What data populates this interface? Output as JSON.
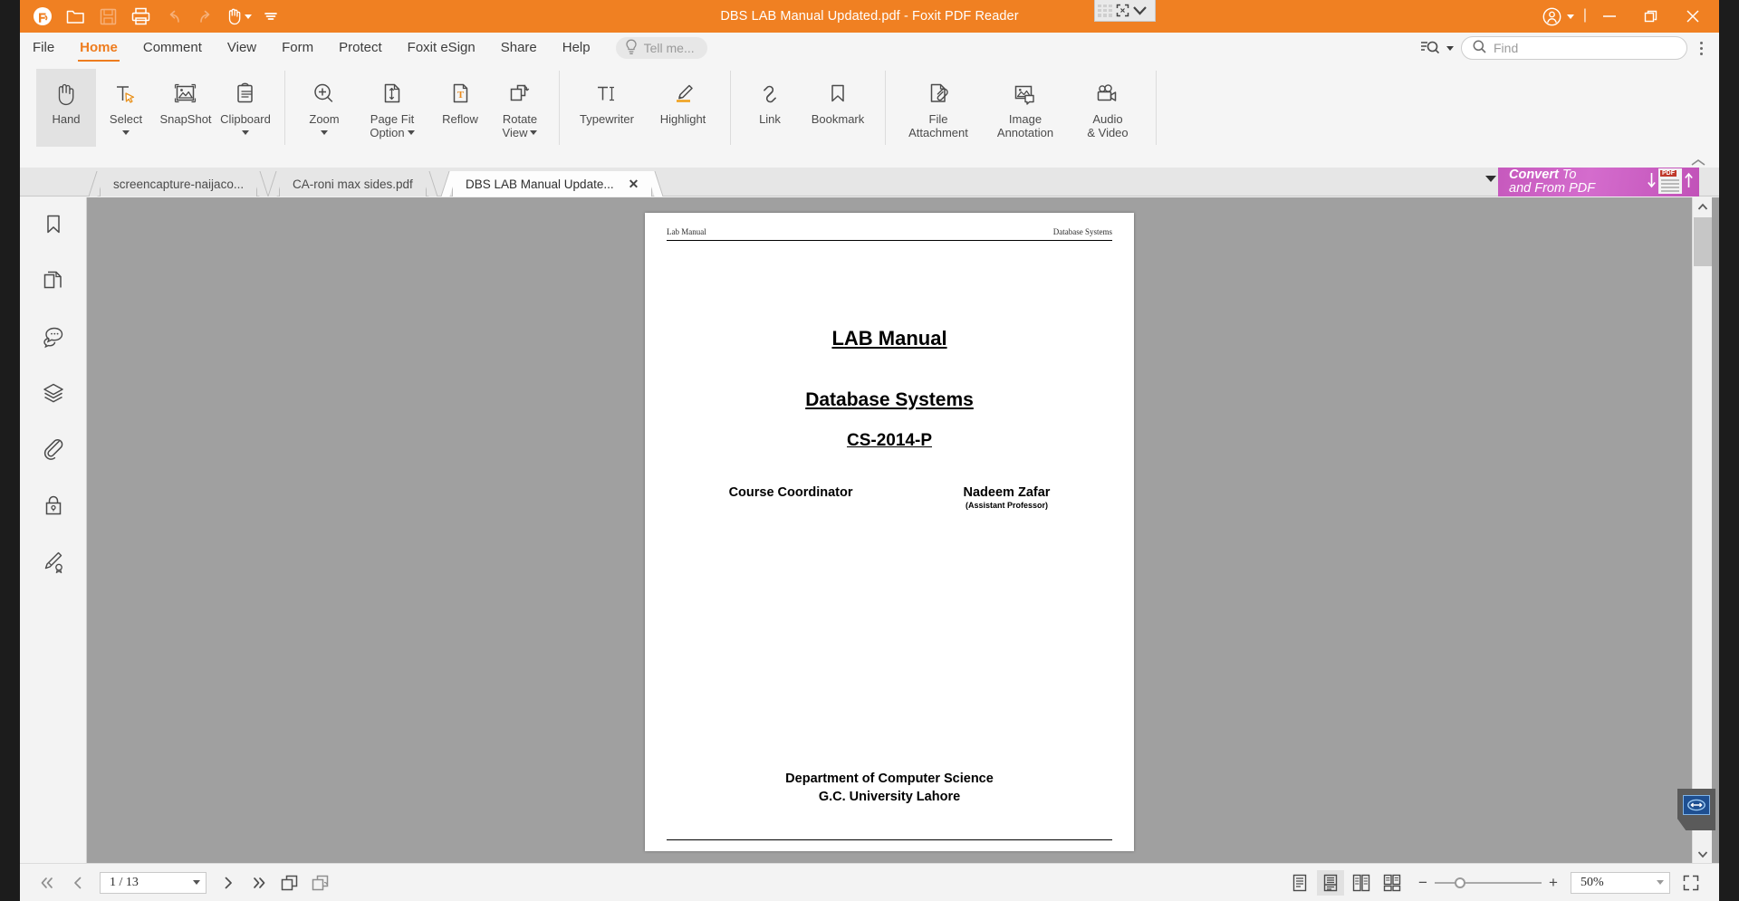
{
  "window": {
    "title": "DBS LAB Manual Updated.pdf - Foxit PDF Reader",
    "accent_color": "#f08022",
    "quick_access": [
      {
        "name": "foxit-logo-icon",
        "label": "Foxit"
      },
      {
        "name": "open-icon",
        "label": "Open"
      },
      {
        "name": "save-icon",
        "label": "Save"
      },
      {
        "name": "print-icon",
        "label": "Print"
      },
      {
        "name": "undo-icon",
        "label": "Undo"
      },
      {
        "name": "redo-icon",
        "label": "Redo"
      },
      {
        "name": "hand-tool-icon",
        "label": "Hand Tool"
      },
      {
        "name": "quick-access-more-icon",
        "label": "Customize Quick Access Toolbar"
      }
    ],
    "controls": {
      "account": "Account",
      "minimize": "Minimize",
      "restore": "Restore",
      "close": "Close"
    },
    "float_widget": {
      "grid": "app-grid-icon",
      "expand": "expand-icon",
      "chevron": "chevron-down-icon"
    }
  },
  "menu": {
    "items": [
      {
        "label": "File",
        "active": false
      },
      {
        "label": "Home",
        "active": true
      },
      {
        "label": "Comment",
        "active": false
      },
      {
        "label": "View",
        "active": false
      },
      {
        "label": "Form",
        "active": false
      },
      {
        "label": "Protect",
        "active": false
      },
      {
        "label": "Foxit eSign",
        "active": false
      },
      {
        "label": "Share",
        "active": false
      },
      {
        "label": "Help",
        "active": false
      }
    ],
    "tell_me_placeholder": "Tell me...",
    "find_placeholder": "Find",
    "search_options_label": "Search options",
    "more_label": "More"
  },
  "ribbon": {
    "groups": [
      {
        "buttons": [
          {
            "label": "Hand",
            "icon": "hand-icon",
            "selected": true,
            "dropdown": false
          },
          {
            "label": "Select",
            "icon": "select-text-icon",
            "selected": false,
            "dropdown": true
          },
          {
            "label": "SnapShot",
            "icon": "snapshot-icon",
            "selected": false,
            "dropdown": false
          },
          {
            "label": "Clipboard",
            "icon": "clipboard-icon",
            "selected": false,
            "dropdown": true
          }
        ]
      },
      {
        "buttons": [
          {
            "label": "Zoom",
            "icon": "zoom-in-icon",
            "selected": false,
            "dropdown": true
          },
          {
            "label": "Page Fit",
            "label2": "Option",
            "icon": "page-fit-icon",
            "selected": false,
            "dropdown": true
          },
          {
            "label": "Reflow",
            "icon": "reflow-icon",
            "selected": false,
            "dropdown": false
          },
          {
            "label": "Rotate",
            "label2": "View",
            "icon": "rotate-view-icon",
            "selected": false,
            "dropdown": true
          }
        ]
      },
      {
        "buttons": [
          {
            "label": "Typewriter",
            "icon": "typewriter-icon",
            "selected": false,
            "dropdown": false
          },
          {
            "label": "Highlight",
            "icon": "highlight-icon",
            "selected": false,
            "dropdown": false
          }
        ]
      },
      {
        "buttons": [
          {
            "label": "Link",
            "icon": "link-icon",
            "selected": false,
            "dropdown": false
          },
          {
            "label": "Bookmark",
            "icon": "bookmark-icon",
            "selected": false,
            "dropdown": false
          }
        ]
      },
      {
        "buttons": [
          {
            "label": "File",
            "label2": "Attachment",
            "icon": "file-attachment-icon",
            "selected": false,
            "dropdown": false
          },
          {
            "label": "Image",
            "label2": "Annotation",
            "icon": "image-annotation-icon",
            "selected": false,
            "dropdown": false
          },
          {
            "label": "Audio",
            "label2": "& Video",
            "icon": "audio-video-icon",
            "selected": false,
            "dropdown": false
          }
        ]
      }
    ],
    "collapse_label": "Collapse the Ribbon"
  },
  "doc_tabs": {
    "items": [
      {
        "label": "screencapture-naijaco...",
        "active": false,
        "closable": false
      },
      {
        "label": "CA-roni max sides.pdf",
        "active": false,
        "closable": false
      },
      {
        "label": "DBS LAB Manual Update...",
        "active": true,
        "closable": true,
        "close_label": "✕"
      }
    ],
    "overflow_label": "Tab list",
    "ad": {
      "line1_bold": "Convert",
      "line1_rest": " To",
      "line2": "and From PDF",
      "badge": "PDF",
      "color": "#c659bd"
    }
  },
  "sidebar": {
    "items": [
      {
        "name": "bookmarks-panel",
        "icon": "bookmark-icon",
        "label": "Bookmarks"
      },
      {
        "name": "pages-panel",
        "icon": "pages-icon",
        "label": "Page Thumbnails"
      },
      {
        "name": "comments-panel",
        "icon": "comment-icon",
        "label": "Comments"
      },
      {
        "name": "layers-panel",
        "icon": "layers-icon",
        "label": "Layers"
      },
      {
        "name": "attachments-panel",
        "icon": "paperclip-icon",
        "label": "Attachments"
      },
      {
        "name": "security-panel",
        "icon": "lock-icon",
        "label": "Security"
      },
      {
        "name": "signatures-panel",
        "icon": "signature-icon",
        "label": "Digital Signatures"
      }
    ],
    "expand_label": "▸"
  },
  "document": {
    "header_left": "Lab Manual",
    "header_right": "Database Systems",
    "title": "LAB Manual",
    "subject": "Database Systems",
    "course_code": "CS-2014-P",
    "coordinator_label": "Course Coordinator",
    "coordinator_name": "Nadeem Zafar",
    "coordinator_role": "(Assistant Professor)",
    "department_line1": "Department of Computer Science",
    "department_line2": "G.C. University Lahore"
  },
  "statusbar": {
    "first_page_label": "First Page",
    "prev_page_label": "Previous Page",
    "page_value": "1 / 13",
    "next_page_label": "Next Page",
    "last_page_label": "Last Page",
    "rotate_label": "Rotate",
    "reflow_label": "Reflow",
    "view_modes": [
      {
        "name": "single-page-view",
        "label": "Single Page",
        "selected": false
      },
      {
        "name": "continuous-view",
        "label": "Continuous",
        "selected": true
      },
      {
        "name": "facing-view",
        "label": "Facing",
        "selected": false
      },
      {
        "name": "facing-continuous-view",
        "label": "Facing Continuous",
        "selected": false
      }
    ],
    "zoom_out_label": "−",
    "zoom_in_label": "+",
    "zoom_value": "50%",
    "fullscreen_label": "Full Screen"
  },
  "scrollbar": {
    "up_label": "Scroll Up",
    "down_label": "Scroll Down",
    "fab_label": "resize-handle-icon"
  }
}
